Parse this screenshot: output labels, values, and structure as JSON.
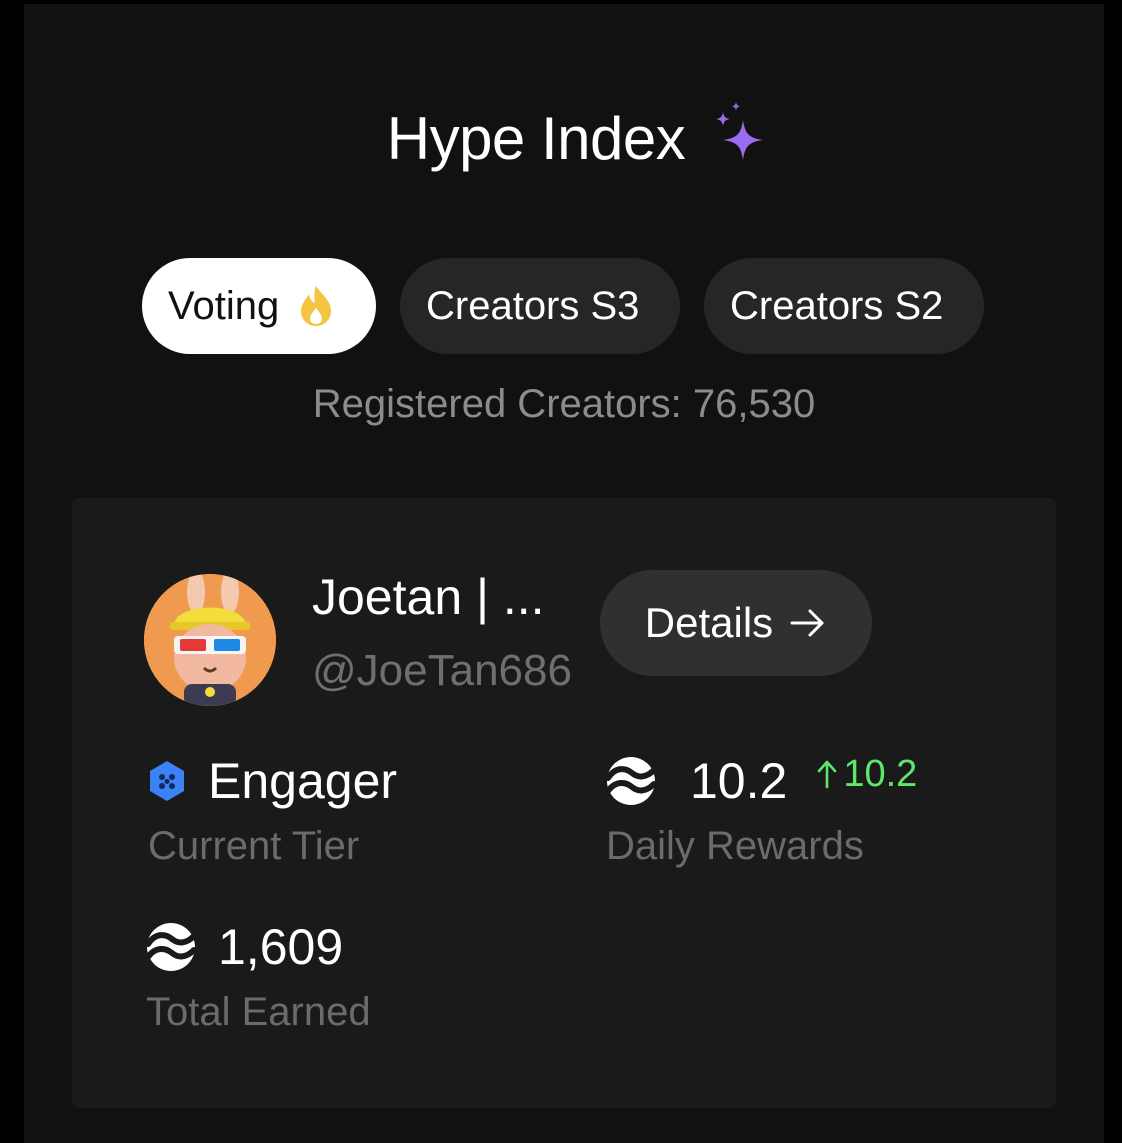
{
  "header": {
    "title": "Hype Index",
    "title_icon": "sparkle-icon"
  },
  "tabs": [
    {
      "label": "Voting",
      "icon": "flame-icon",
      "active": true
    },
    {
      "label": "Creators S3",
      "active": false
    },
    {
      "label": "Creators S2",
      "active": false
    }
  ],
  "registered_creators": "Registered Creators: 76,530",
  "profile": {
    "name": "Joetan | ...",
    "handle": "@JoeTan686",
    "details_label": "Details",
    "details_icon": "arrow-right-icon"
  },
  "stats": {
    "tier": {
      "value": "Engager",
      "label": "Current Tier",
      "icon": "hexagon-tier-icon"
    },
    "daily": {
      "value": "10.2",
      "change": "10.2",
      "label": "Daily Rewards",
      "icon": "token-coin-icon"
    },
    "total": {
      "value": "1,609",
      "label": "Total Earned",
      "icon": "token-coin-icon"
    }
  },
  "colors": {
    "accent_purple": "#9b6cf0",
    "positive_green": "#5ee86a",
    "flame_yellow": "#f6c443",
    "tier_blue": "#3b82f6"
  }
}
